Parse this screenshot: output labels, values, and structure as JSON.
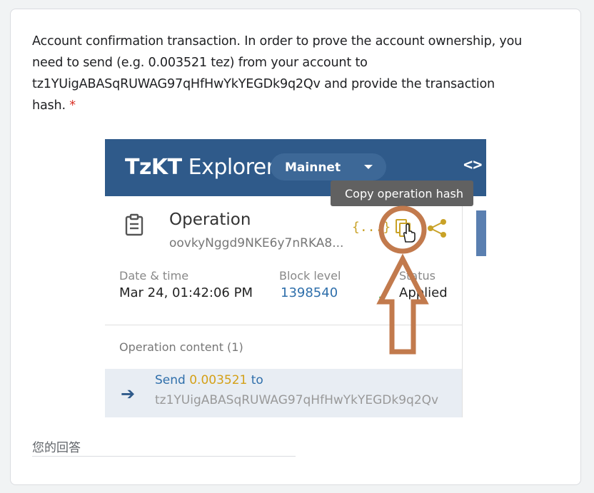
{
  "question": {
    "line1": "Account confirmation transaction. In order to prove the account ownership, you",
    "line2": "need to send (e.g. 0.003521 tez) from your account to",
    "line3": "tz1YUigABASqRUWAG97qHfHwYkYEGDk9q2Qv and provide the transaction",
    "line4": "hash.",
    "required_mark": "*"
  },
  "screenshot": {
    "logo_bold": "TzKT",
    "logo_rest": " Explorer",
    "network": "Mainnet",
    "code_toggle": "<>",
    "tooltip": "Copy operation hash",
    "operation_title": "Operation",
    "operation_hash": "oovkyNggd9NKE6y7nRKA8...",
    "json_icon": "{...}",
    "date_label": "Date & time",
    "date_value": "Mar 24, 01:42:06 PM",
    "block_label": "Block level",
    "block_value": "1398540",
    "status_label": "Status",
    "status_value": "Applied",
    "content_label": "Operation content (1)",
    "send_prefix": "Send",
    "send_amount": "0.003521",
    "send_suffix": "to",
    "send_address": "tz1YUigABASqRUWAG97qHfHwYkYEGDk9q2Qv"
  },
  "answer": {
    "placeholder": "您的回答"
  },
  "colors": {
    "header": "#2f5a8a",
    "annotation": "#c27a4d",
    "amount": "#d4a017",
    "link": "#2f6fab"
  }
}
